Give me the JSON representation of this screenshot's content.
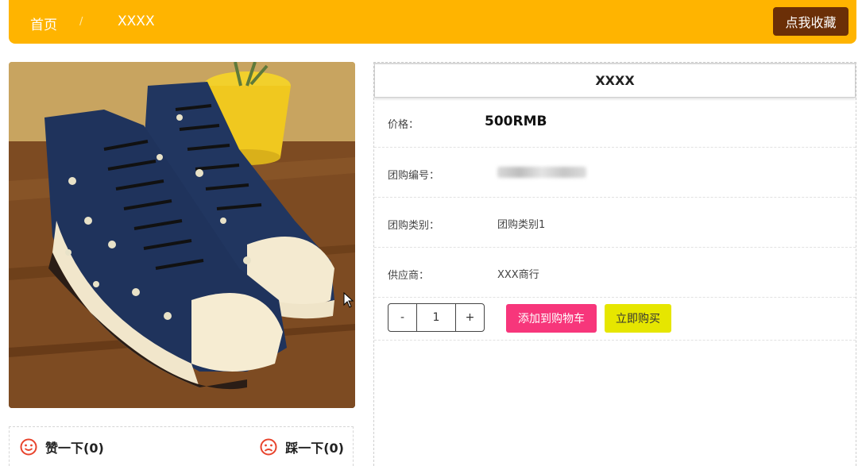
{
  "breadcrumb": {
    "home": "首页",
    "separator": "/",
    "current": "XXXX"
  },
  "header": {
    "favorite_button": "点我收藏",
    "bar_color": "#ffb400",
    "button_color": "#6b2f07"
  },
  "product": {
    "image_alt": "product-photo-high-top-sneakers",
    "title": "XXXX",
    "price_label": "价格：",
    "price_value": "500RMB",
    "group_id_label": "团购编号：",
    "group_id_value": "",
    "group_category_label": "团购类别：",
    "group_category_value": "团购类别1",
    "supplier_label": "供应商：",
    "supplier_value": "XXX商行"
  },
  "purchase": {
    "minus": "-",
    "quantity": "1",
    "plus": "+",
    "add_to_cart": "添加到购物车",
    "buy_now": "立即购买",
    "cart_color": "#f7367b",
    "buy_color": "#e6e600"
  },
  "votes": {
    "like_label": "赞一下(0)",
    "dislike_label": "踩一下(0)",
    "icon_like": "smile-face-icon",
    "icon_dislike": "sad-face-icon"
  }
}
